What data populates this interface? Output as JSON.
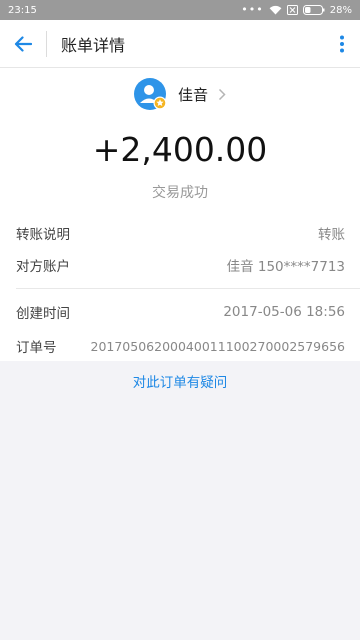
{
  "status_bar": {
    "time": "23:15",
    "dots": "•••",
    "battery": "28%"
  },
  "header": {
    "title": "账单详情",
    "back_icon": "arrow-left-icon",
    "more_icon": "more-vertical-icon"
  },
  "user": {
    "name": "佳音"
  },
  "transaction": {
    "amount": "+2,400.00",
    "status": "交易成功",
    "details": [
      {
        "label": "转账说明",
        "value": "转账"
      },
      {
        "label": "对方账户",
        "value": "佳音 150****7713"
      },
      {
        "label": "创建时间",
        "value": "2017-05-06 18:56"
      },
      {
        "label": "订单号",
        "value": "20170506200040011100270002579656"
      }
    ]
  },
  "question_link": "对此订单有疑问",
  "colors": {
    "accent": "#1e88e5",
    "status_bar": "#9a9a9a",
    "background": "#f3f3f7"
  }
}
